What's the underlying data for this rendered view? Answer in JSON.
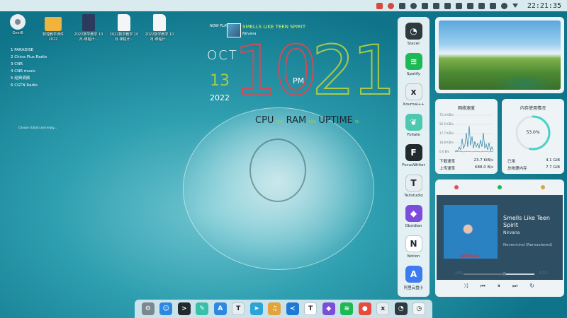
{
  "topbar": {
    "clock": "22:21:35",
    "tray_icons": [
      "notify-icon",
      "alert-icon",
      "pin-icon",
      "weather-icon",
      "doc-icon",
      "play-icon",
      "pause-icon",
      "window-icon",
      "grid-icon",
      "bluetooth-icon",
      "volume-icon",
      "wifi-icon",
      "caret-down-icon"
    ]
  },
  "desktop_icons": [
    {
      "label": "Gnet8",
      "icon": "gear-icon"
    },
    {
      "label": "数理教学课件 2022",
      "icon": "folder-icon"
    },
    {
      "label": "2022数学教学 10月-课程计...",
      "icon": "book-icon"
    },
    {
      "label": "2022数学教学 10月-课程计...",
      "icon": "document-icon"
    },
    {
      "label": "2022数学教学 10月-课程计...",
      "icon": "document-icon"
    }
  ],
  "radio_list": [
    "1  PARADISE",
    "2  China Plus Radio",
    "3  CNR",
    "4  CNR music",
    "5  经典调频",
    "6  CGTN Radio"
  ],
  "radio_status": "Choose station and enjoy...",
  "clock_widget": {
    "now_playing_label": "NOW PLAYING",
    "song": "SMELLS LIKE TEEN SPIRIT",
    "artist": "Nirvana",
    "month": "OCT",
    "day": "13",
    "year": "2022",
    "hour": "10",
    "ampm": "PM",
    "minute": "21",
    "cpu_label": "CPU",
    "cpu_val": "20%",
    "ram_label": "RAM",
    "ram_val": "53%",
    "uptime_label": "UPTIME",
    "uptime_val": "5h"
  },
  "app_panel": [
    {
      "name": "Stacer",
      "glyph": "◔",
      "color": "#2f3a40"
    },
    {
      "name": "Spotify",
      "glyph": "≋",
      "color": "#1db954"
    },
    {
      "name": "Xournal++",
      "glyph": "x",
      "color": "#e8edf0"
    },
    {
      "name": "Foliate",
      "glyph": "❦",
      "color": "#4cc9b0"
    },
    {
      "name": "FocusWriter",
      "glyph": "F",
      "color": "#222a2e"
    },
    {
      "name": "TeXstudio",
      "glyph": "T",
      "color": "#e8edf0"
    },
    {
      "name": "Obsidian",
      "glyph": "◆",
      "color": "#7c4ddb"
    },
    {
      "name": "Notion",
      "glyph": "N",
      "color": "#ffffff"
    },
    {
      "name": "阿里云盘小",
      "glyph": "A",
      "color": "#3d7bf0"
    }
  ],
  "net_widget": {
    "title": "网络速度",
    "ticks": [
      "75.4 KiB/s",
      "56.5 KiB/s",
      "37.7 KiB/s",
      "18.8 KiB/s",
      "0.0 B/s"
    ],
    "down_label": "下载速率",
    "down_val": "23.7 KiB/s",
    "up_label": "上传速率",
    "up_val": "688.0 B/s",
    "down_color": "#2a7fa0",
    "up_color": "#d8483e"
  },
  "mem_widget": {
    "title": "内存使用情况",
    "percent": 53.0,
    "percent_label": "53.0%",
    "used_label": "已用",
    "used_val": "4.1 GiB",
    "total_label": "总物理内存",
    "total_val": "7.7 GiB",
    "ring_color": "#4cd0c8"
  },
  "music_widget": {
    "song": "Smells Like Teen Spirit",
    "artist": "Nirvana",
    "album": "Nevermind (Remastered)",
    "cover_text": "NIRVANA",
    "elapsed": "2:51",
    "total": "-2:11",
    "progress": 0.57,
    "controls": [
      "shuffle-icon",
      "previous-icon",
      "pause-icon",
      "next-icon",
      "repeat-icon"
    ],
    "tabs": [
      "heart-icon",
      "spotify-icon",
      "vlc-icon"
    ]
  },
  "dock": [
    {
      "name": "system-settings",
      "glyph": "⚙",
      "color": "#7a8890"
    },
    {
      "name": "finder",
      "glyph": "☺",
      "color": "#2f88e0"
    },
    {
      "name": "terminal",
      "glyph": ">",
      "color": "#222a2e"
    },
    {
      "name": "notes",
      "glyph": "✎",
      "color": "#38c0a8"
    },
    {
      "name": "app-store",
      "glyph": "A",
      "color": "#2f88e0"
    },
    {
      "name": "texstudio",
      "glyph": "T",
      "color": "#e8edf0"
    },
    {
      "name": "telegram",
      "glyph": "➤",
      "color": "#2ea3d8"
    },
    {
      "name": "music-player",
      "glyph": "♫",
      "color": "#e2a33a"
    },
    {
      "name": "vscode",
      "glyph": "≺",
      "color": "#1f7ad6"
    },
    {
      "name": "typora",
      "glyph": "T",
      "color": "#ffffff"
    },
    {
      "name": "obsidian",
      "glyph": "◆",
      "color": "#7c4ddb"
    },
    {
      "name": "spotify",
      "glyph": "≋",
      "color": "#1db954"
    },
    {
      "name": "chrome",
      "glyph": "●",
      "color": "#e84b3c"
    },
    {
      "name": "xournal",
      "glyph": "x",
      "color": "#e8edf0"
    },
    {
      "name": "stacer",
      "glyph": "◔",
      "color": "#2f3a40"
    },
    {
      "name": "clock",
      "glyph": "◷",
      "color": "#f2f4f6"
    }
  ]
}
